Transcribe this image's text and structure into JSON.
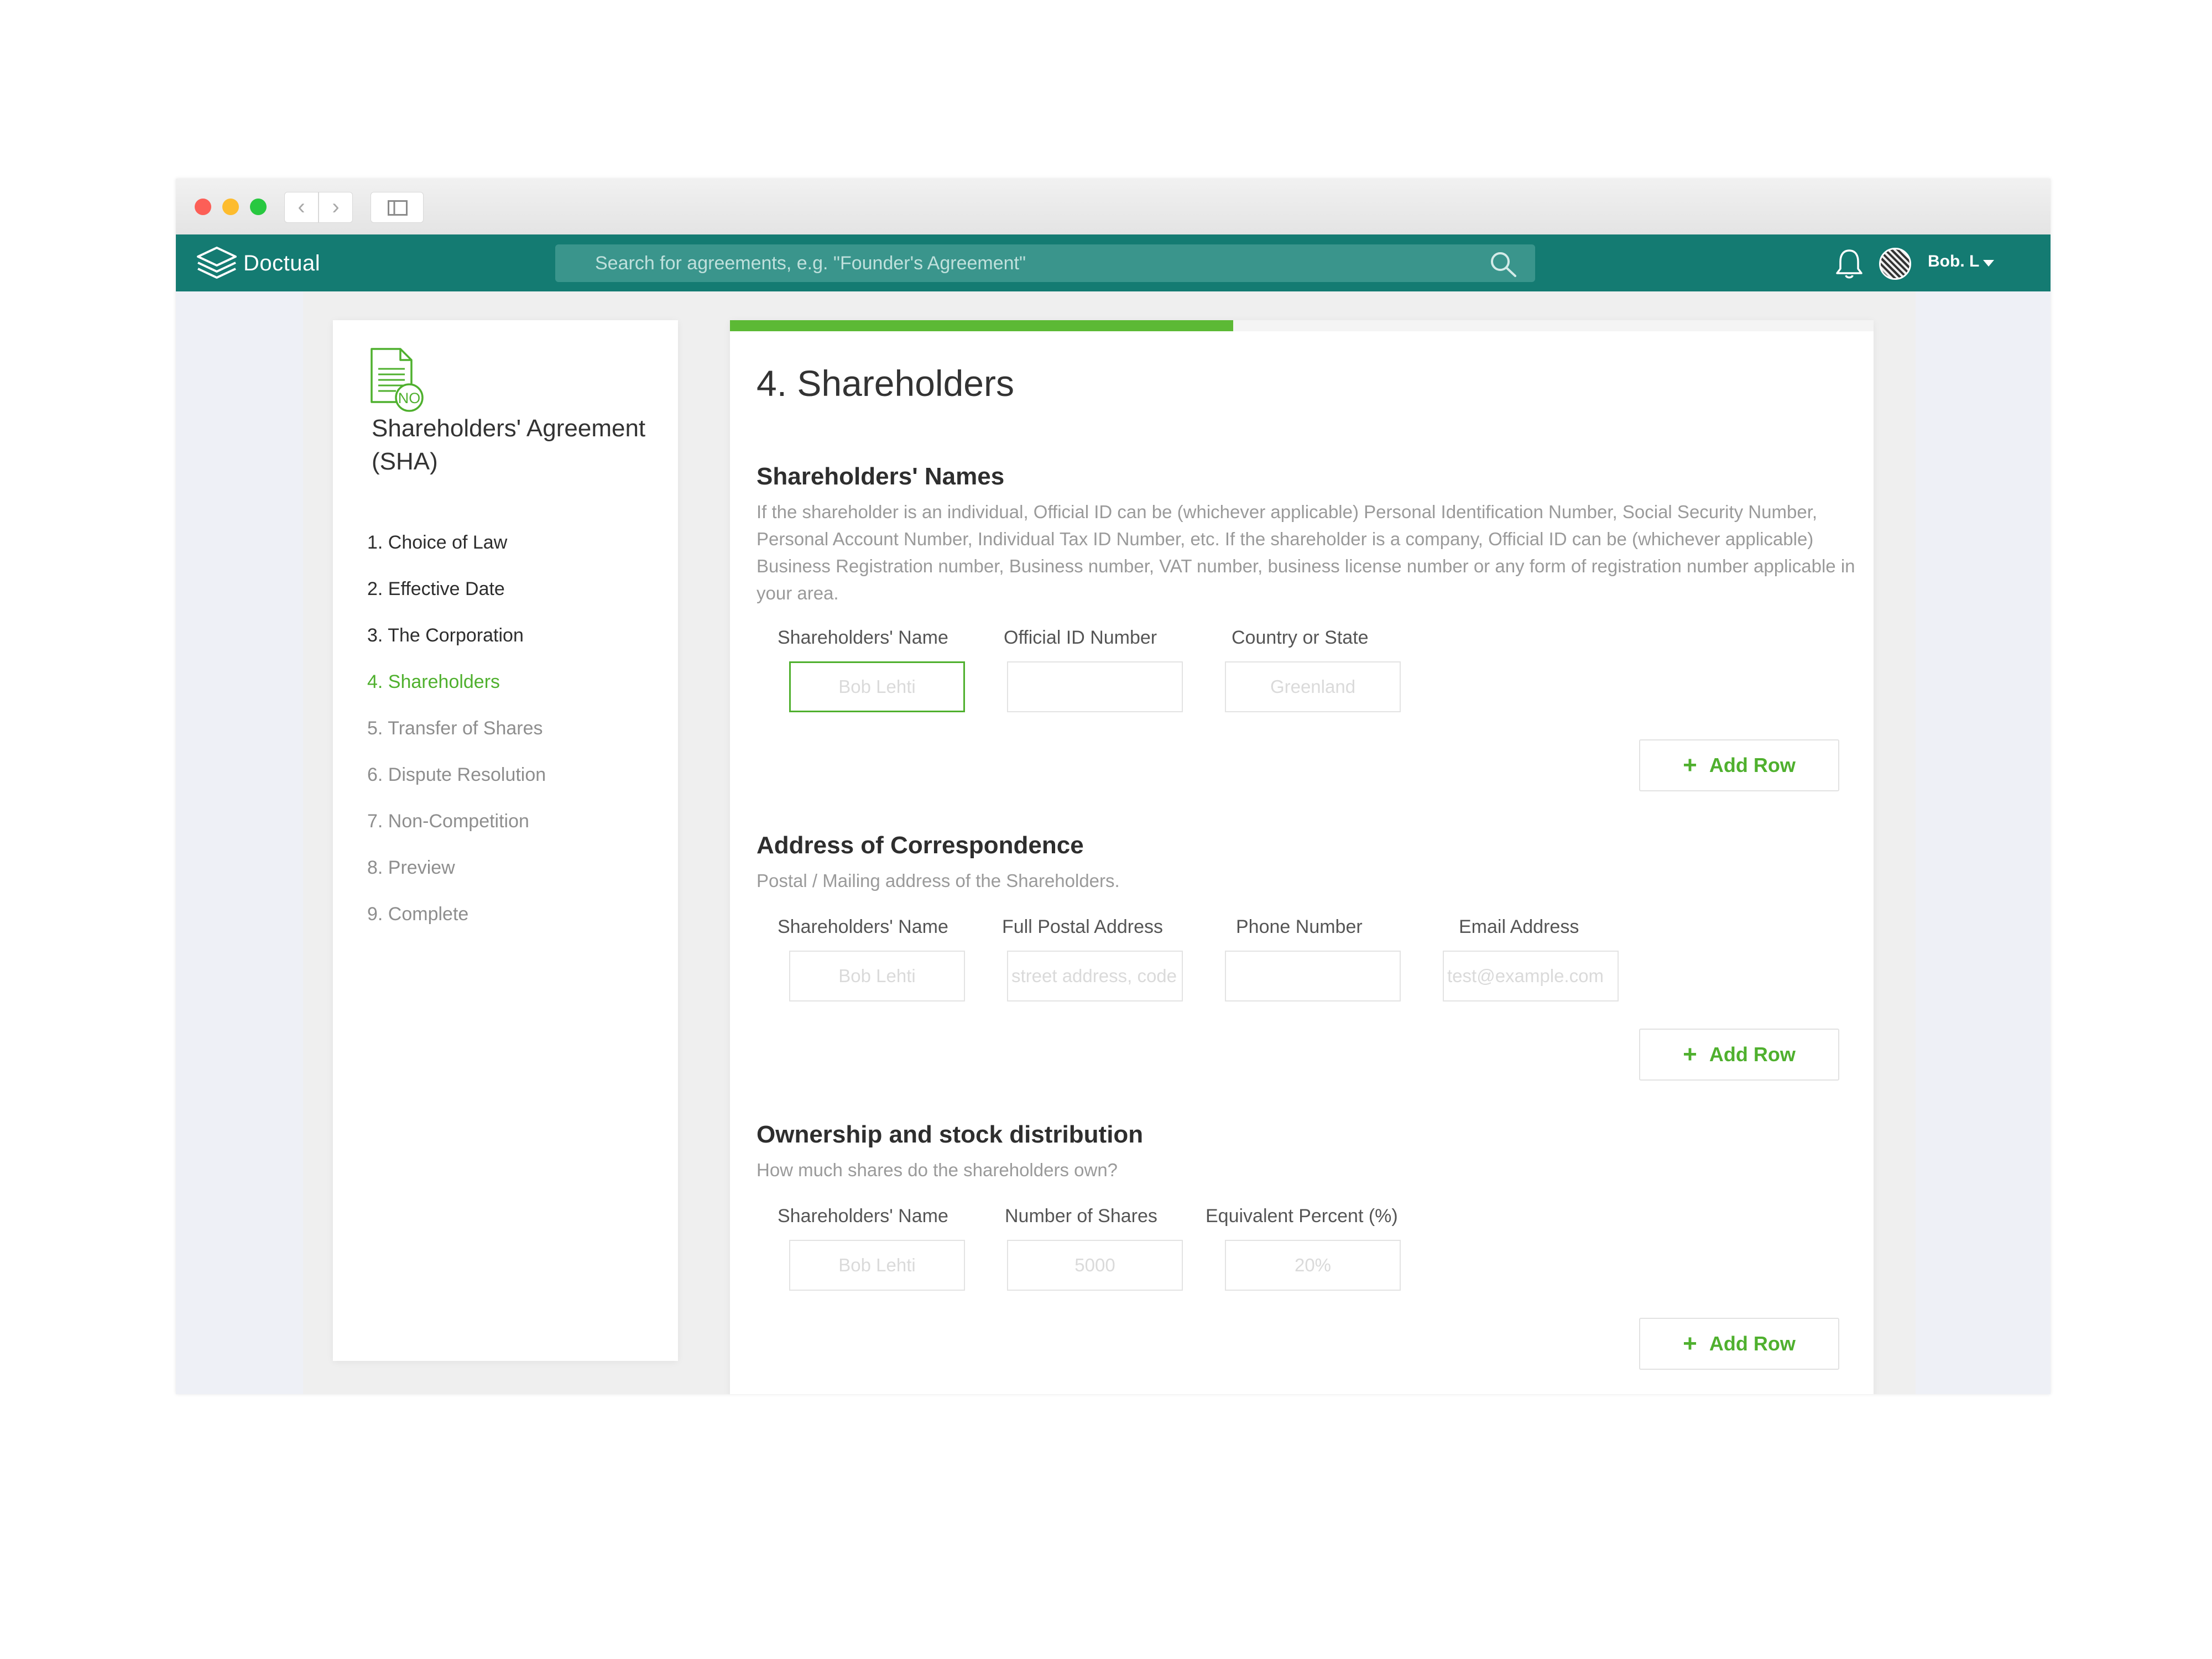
{
  "browser": {
    "back_glyph": "‹",
    "forward_glyph": "›"
  },
  "app": {
    "brand": "Doctual",
    "search_placeholder": "Search for agreements, e.g. \"Founder's Agreement\"",
    "user_name": "Bob. L"
  },
  "sidebar": {
    "doc_badge": "NO",
    "agreement_title": "Shareholders' Agreement (SHA)",
    "steps": [
      {
        "label": "1. Choice of Law",
        "state": "done"
      },
      {
        "label": "2. Effective Date",
        "state": "done"
      },
      {
        "label": "3. The Corporation",
        "state": "done"
      },
      {
        "label": "4. Shareholders",
        "state": "active"
      },
      {
        "label": "5. Transfer of Shares",
        "state": "pending"
      },
      {
        "label": "6. Dispute Resolution",
        "state": "pending"
      },
      {
        "label": "7. Non-Competition",
        "state": "pending"
      },
      {
        "label": "8. Preview",
        "state": "pending"
      },
      {
        "label": "9. Complete",
        "state": "pending"
      }
    ]
  },
  "main": {
    "progress_fraction": 0.44,
    "page_title": "4. Shareholders",
    "add_row_plus": "+",
    "add_row_label": "Add Row",
    "sections": [
      {
        "title": "Shareholders' Names",
        "description": "If the shareholder is an individual, Official ID can be (whichever applicable) Personal Identification Number, Social Security Number, Personal Account Number, Individual Tax ID Number, etc. If the shareholder is a company, Official ID can be (whichever applicable) Business Registration number, Business number, VAT number, business license number or any form of registration number applicable in your area.",
        "columns": [
          "Shareholders' Name",
          "Official ID Number",
          "Country or State"
        ],
        "placeholders": [
          "Bob Lehti",
          "",
          "Greenland"
        ]
      },
      {
        "title": "Address of Correspondence",
        "description": "Postal / Mailing address of the Shareholders.",
        "columns": [
          "Shareholders' Name",
          "Full Postal Address",
          "Phone Number",
          "Email Address"
        ],
        "placeholders": [
          "Bob Lehti",
          "street address, code",
          "",
          "test@example.com"
        ]
      },
      {
        "title": "Ownership and stock distribution",
        "description": "How much shares do the shareholders own?",
        "columns": [
          "Shareholders' Name",
          "Number of Shares",
          "Equivalent Percent (%)"
        ],
        "placeholders": [
          "Bob Lehti",
          "5000",
          "20%"
        ]
      }
    ]
  },
  "colors": {
    "header_teal": "#147b72",
    "accent_green": "#4fb02e",
    "progress_green": "#5cb935"
  }
}
